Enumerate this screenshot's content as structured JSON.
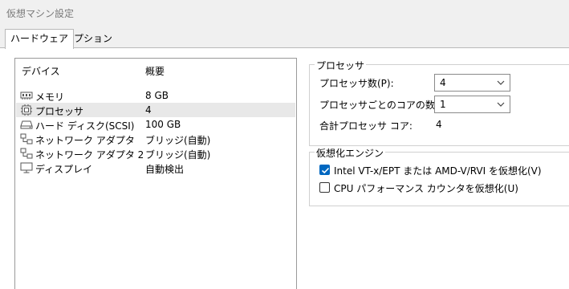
{
  "window": {
    "title": "仮想マシン設定"
  },
  "tabs": [
    {
      "label": "ハードウェア",
      "active": true
    },
    {
      "label": "オプション",
      "active": false
    }
  ],
  "device_list": {
    "headers": {
      "device": "デバイス",
      "summary": "概要"
    },
    "rows": [
      {
        "name": "メモリ",
        "summary": "8 GB",
        "icon": "memory-icon",
        "selected": false
      },
      {
        "name": "プロセッサ",
        "summary": "4",
        "icon": "processor-icon",
        "selected": true
      },
      {
        "name": "ハード ディスク(SCSI)",
        "summary": "100 GB",
        "icon": "hard-disk-icon",
        "selected": false
      },
      {
        "name": "ネットワーク アダプタ",
        "summary": "ブリッジ(自動)",
        "icon": "network-adapter-icon",
        "selected": false
      },
      {
        "name": "ネットワーク アダプタ 2",
        "summary": "ブリッジ(自動)",
        "icon": "network-adapter-icon",
        "selected": false
      },
      {
        "name": "ディスプレイ",
        "summary": "自動検出",
        "icon": "display-icon",
        "selected": false
      }
    ]
  },
  "processor_group": {
    "legend": "プロセッサ",
    "processor_count_label": "プロセッサ数(P):",
    "processor_count_value": "4",
    "cores_per_processor_label": "プロセッサごとのコアの数(C):",
    "cores_per_processor_value": "1",
    "total_cores_label": "合計プロセッサ コア:",
    "total_cores_value": "4"
  },
  "virtualization_group": {
    "legend": "仮想化エンジン",
    "options": [
      {
        "label": "Intel VT-x/EPT または AMD-V/RVI を仮想化(V)",
        "checked": true
      },
      {
        "label": "CPU パフォーマンス カウンタを仮想化(U)",
        "checked": false
      }
    ]
  },
  "colors": {
    "accent": "#0067c0",
    "selected_row": "#e8e8e8"
  }
}
